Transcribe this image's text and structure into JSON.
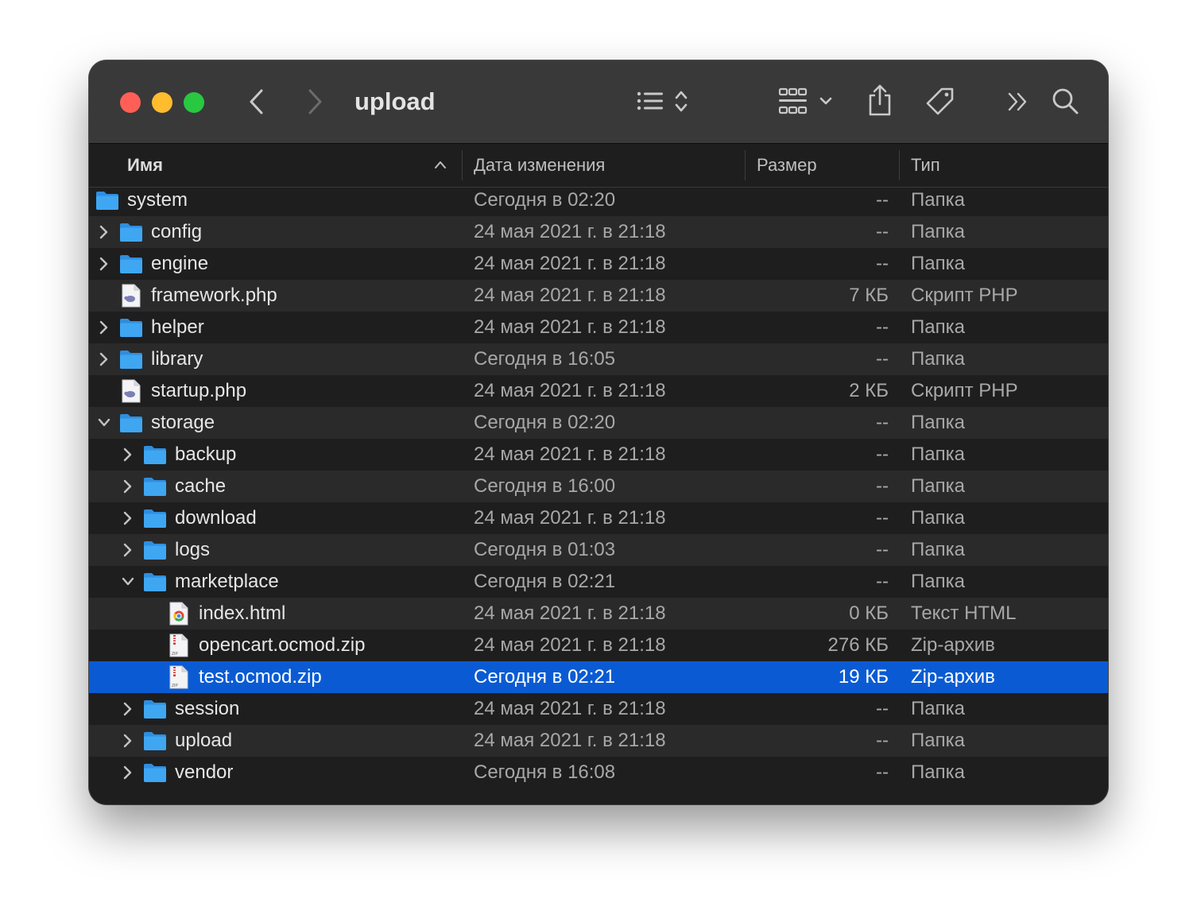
{
  "window": {
    "title": "upload"
  },
  "toolbar": {
    "icons": [
      "back-chevron-icon",
      "forward-chevron-icon",
      "list-view-icon",
      "view-options-icon",
      "group-grid-icon",
      "share-icon",
      "tag-icon",
      "more-chevrons-icon",
      "search-icon"
    ]
  },
  "columns": {
    "name": "Имя",
    "date": "Дата изменения",
    "size": "Размер",
    "type": "Тип"
  },
  "colors": {
    "selection": "#0a5bd3",
    "folder": "#3fa6f2",
    "close": "#ff5f57",
    "minimize": "#febc2e",
    "zoom": "#28c840"
  },
  "rows": [
    {
      "name": "system",
      "date": "Сегодня в 02:20",
      "size": "--",
      "type": "Папка",
      "kind": "folder",
      "indent": 0,
      "disclosure": "none"
    },
    {
      "name": "config",
      "date": "24 мая 2021 г. в 21:18",
      "size": "--",
      "type": "Папка",
      "kind": "folder",
      "indent": 1,
      "disclosure": "collapsed"
    },
    {
      "name": "engine",
      "date": "24 мая 2021 г. в 21:18",
      "size": "--",
      "type": "Папка",
      "kind": "folder",
      "indent": 1,
      "disclosure": "collapsed"
    },
    {
      "name": "framework.php",
      "date": "24 мая 2021 г. в 21:18",
      "size": "7 КБ",
      "type": "Скрипт PHP",
      "kind": "php",
      "indent": 1,
      "disclosure": "none"
    },
    {
      "name": "helper",
      "date": "24 мая 2021 г. в 21:18",
      "size": "--",
      "type": "Папка",
      "kind": "folder",
      "indent": 1,
      "disclosure": "collapsed"
    },
    {
      "name": "library",
      "date": "Сегодня в 16:05",
      "size": "--",
      "type": "Папка",
      "kind": "folder",
      "indent": 1,
      "disclosure": "collapsed"
    },
    {
      "name": "startup.php",
      "date": "24 мая 2021 г. в 21:18",
      "size": "2 КБ",
      "type": "Скрипт PHP",
      "kind": "php",
      "indent": 1,
      "disclosure": "none"
    },
    {
      "name": "storage",
      "date": "Сегодня в 02:20",
      "size": "--",
      "type": "Папка",
      "kind": "folder",
      "indent": 1,
      "disclosure": "expanded"
    },
    {
      "name": "backup",
      "date": "24 мая 2021 г. в 21:18",
      "size": "--",
      "type": "Папка",
      "kind": "folder",
      "indent": 2,
      "disclosure": "collapsed"
    },
    {
      "name": "cache",
      "date": "Сегодня в 16:00",
      "size": "--",
      "type": "Папка",
      "kind": "folder",
      "indent": 2,
      "disclosure": "collapsed"
    },
    {
      "name": "download",
      "date": "24 мая 2021 г. в 21:18",
      "size": "--",
      "type": "Папка",
      "kind": "folder",
      "indent": 2,
      "disclosure": "collapsed"
    },
    {
      "name": "logs",
      "date": "Сегодня в 01:03",
      "size": "--",
      "type": "Папка",
      "kind": "folder",
      "indent": 2,
      "disclosure": "collapsed"
    },
    {
      "name": "marketplace",
      "date": "Сегодня в 02:21",
      "size": "--",
      "type": "Папка",
      "kind": "folder",
      "indent": 2,
      "disclosure": "expanded"
    },
    {
      "name": "index.html",
      "date": "24 мая 2021 г. в 21:18",
      "size": "0 КБ",
      "type": "Текст HTML",
      "kind": "html",
      "indent": 3,
      "disclosure": "none"
    },
    {
      "name": "opencart.ocmod.zip",
      "date": "24 мая 2021 г. в 21:18",
      "size": "276 КБ",
      "type": "Zip-архив",
      "kind": "zip",
      "indent": 3,
      "disclosure": "none"
    },
    {
      "name": "test.ocmod.zip",
      "date": "Сегодня в 02:21",
      "size": "19 КБ",
      "type": "Zip-архив",
      "kind": "zip",
      "indent": 3,
      "disclosure": "none",
      "selected": true
    },
    {
      "name": "session",
      "date": "24 мая 2021 г. в 21:18",
      "size": "--",
      "type": "Папка",
      "kind": "folder",
      "indent": 2,
      "disclosure": "collapsed"
    },
    {
      "name": "upload",
      "date": "24 мая 2021 г. в 21:18",
      "size": "--",
      "type": "Папка",
      "kind": "folder",
      "indent": 2,
      "disclosure": "collapsed"
    },
    {
      "name": "vendor",
      "date": "Сегодня в 16:08",
      "size": "--",
      "type": "Папка",
      "kind": "folder",
      "indent": 2,
      "disclosure": "collapsed"
    }
  ]
}
